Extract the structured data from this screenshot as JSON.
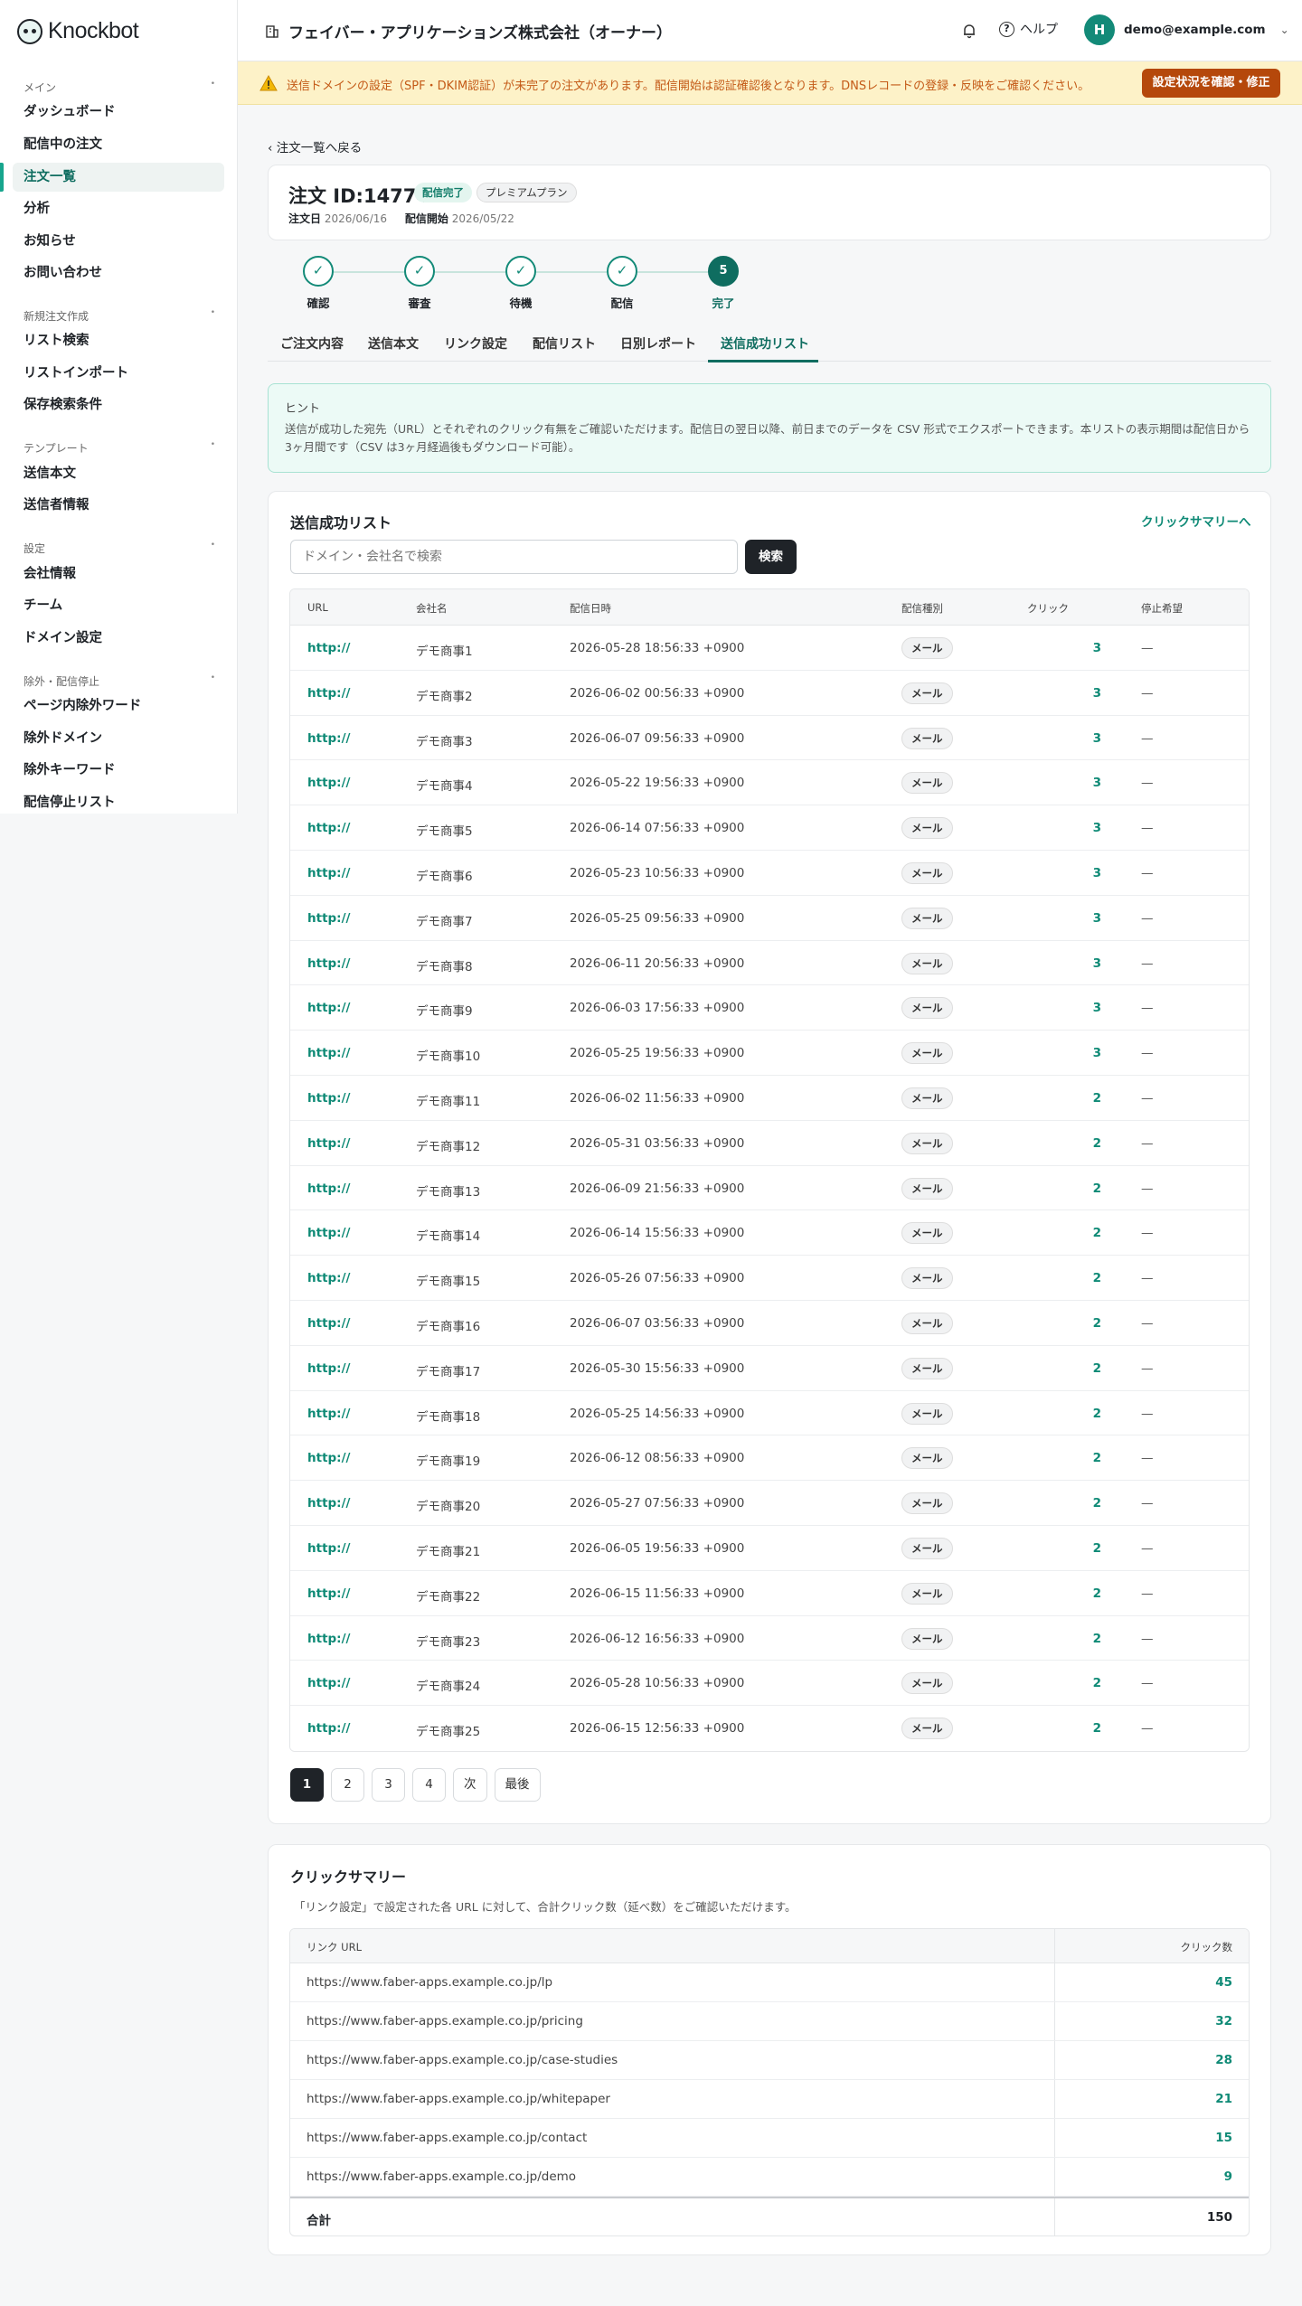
{
  "app": {
    "logo_text": "Knockbot"
  },
  "sidebar": {
    "sections": [
      {
        "label": "メイン",
        "items": [
          "ダッシュボード",
          "配信中の注文",
          "注文一覧",
          "分析",
          "お知らせ",
          "お問い合わせ"
        ]
      },
      {
        "label": "新規注文作成",
        "items": [
          "リスト検索",
          "リストインポート",
          "保存検索条件"
        ]
      },
      {
        "label": "テンプレート",
        "items": [
          "送信本文",
          "送信者情報"
        ]
      },
      {
        "label": "設定",
        "items": [
          "会社情報",
          "チーム",
          "ドメイン設定"
        ]
      },
      {
        "label": "除外・配信停止",
        "items": [
          "ページ内除外ワード",
          "除外ドメイン",
          "除外キーワード",
          "配信停止リスト"
        ]
      }
    ],
    "collapse_glyph": "•"
  },
  "header": {
    "company": "フェイバー・アプリケーションズ株式会社（オーナー）",
    "help": "ヘルプ",
    "help_glyph": "?",
    "avatar_letter": "H",
    "email": "demo@example.com",
    "chevron": "⌄"
  },
  "warning": {
    "text": "送信ドメインの設定（SPF・DKIM認証）が未完了の注文があります。配信開始は認証確認後となります。DNSレコードの登録・反映をご確認ください。",
    "button": "設定状況を確認・修正"
  },
  "back_link": "‹ 注文一覧へ戻る",
  "order": {
    "title": "注文 ID:14774",
    "status_badge": "配信完了",
    "plan_badge": "プレミアムプラン",
    "date_label": "注文日",
    "date_value": "2026/06/16",
    "start_label": "配信開始",
    "start_value": "2026/05/22"
  },
  "steps": [
    {
      "label": "確認",
      "mark": "✓"
    },
    {
      "label": "審査",
      "mark": "✓"
    },
    {
      "label": "待機",
      "mark": "✓"
    },
    {
      "label": "配信",
      "mark": "✓"
    },
    {
      "label": "完了",
      "mark": "5"
    }
  ],
  "tabs": [
    "ご注文内容",
    "送信本文",
    "リンク設定",
    "配信リスト",
    "日別レポート",
    "送信成功リスト"
  ],
  "hint": {
    "title": "ヒント",
    "text": "送信が成功した宛先（URL）とそれぞれのクリック有無をご確認いただけます。配信日の翌日以降、前日までのデータを CSV 形式でエクスポートできます。本リストの表示期間は配信日から3ヶ月間です（CSV は3ヶ月経過後もダウンロード可能）。"
  },
  "success_list": {
    "title": "送信成功リスト",
    "summary_link": "クリックサマリーへ",
    "search_placeholder": "ドメイン・会社名で検索",
    "search_button": "検索",
    "columns": [
      "URL",
      "会社名",
      "配信日時",
      "配信種別",
      "クリック",
      "停止希望"
    ],
    "rows": [
      [
        "http://",
        "デモ商事1",
        "2026-05-28 18:56:33 +0900",
        "メール",
        "3",
        "—"
      ],
      [
        "http://",
        "デモ商事2",
        "2026-06-02 00:56:33 +0900",
        "メール",
        "3",
        "—"
      ],
      [
        "http://",
        "デモ商事3",
        "2026-06-07 09:56:33 +0900",
        "メール",
        "3",
        "—"
      ],
      [
        "http://",
        "デモ商事4",
        "2026-05-22 19:56:33 +0900",
        "メール",
        "3",
        "—"
      ],
      [
        "http://",
        "デモ商事5",
        "2026-06-14 07:56:33 +0900",
        "メール",
        "3",
        "—"
      ],
      [
        "http://",
        "デモ商事6",
        "2026-05-23 10:56:33 +0900",
        "メール",
        "3",
        "—"
      ],
      [
        "http://",
        "デモ商事7",
        "2026-05-25 09:56:33 +0900",
        "メール",
        "3",
        "—"
      ],
      [
        "http://",
        "デモ商事8",
        "2026-06-11 20:56:33 +0900",
        "メール",
        "3",
        "—"
      ],
      [
        "http://",
        "デモ商事9",
        "2026-06-03 17:56:33 +0900",
        "メール",
        "3",
        "—"
      ],
      [
        "http://",
        "デモ商事10",
        "2026-05-25 19:56:33 +0900",
        "メール",
        "3",
        "—"
      ],
      [
        "http://",
        "デモ商事11",
        "2026-06-02 11:56:33 +0900",
        "メール",
        "2",
        "—"
      ],
      [
        "http://",
        "デモ商事12",
        "2026-05-31 03:56:33 +0900",
        "メール",
        "2",
        "—"
      ],
      [
        "http://",
        "デモ商事13",
        "2026-06-09 21:56:33 +0900",
        "メール",
        "2",
        "—"
      ],
      [
        "http://",
        "デモ商事14",
        "2026-06-14 15:56:33 +0900",
        "メール",
        "2",
        "—"
      ],
      [
        "http://",
        "デモ商事15",
        "2026-05-26 07:56:33 +0900",
        "メール",
        "2",
        "—"
      ],
      [
        "http://",
        "デモ商事16",
        "2026-06-07 03:56:33 +0900",
        "メール",
        "2",
        "—"
      ],
      [
        "http://",
        "デモ商事17",
        "2026-05-30 15:56:33 +0900",
        "メール",
        "2",
        "—"
      ],
      [
        "http://",
        "デモ商事18",
        "2026-05-25 14:56:33 +0900",
        "メール",
        "2",
        "—"
      ],
      [
        "http://",
        "デモ商事19",
        "2026-06-12 08:56:33 +0900",
        "メール",
        "2",
        "—"
      ],
      [
        "http://",
        "デモ商事20",
        "2026-05-27 07:56:33 +0900",
        "メール",
        "2",
        "—"
      ],
      [
        "http://",
        "デモ商事21",
        "2026-06-05 19:56:33 +0900",
        "メール",
        "2",
        "—"
      ],
      [
        "http://",
        "デモ商事22",
        "2026-06-15 11:56:33 +0900",
        "メール",
        "2",
        "—"
      ],
      [
        "http://",
        "デモ商事23",
        "2026-06-12 16:56:33 +0900",
        "メール",
        "2",
        "—"
      ],
      [
        "http://",
        "デモ商事24",
        "2026-05-28 10:56:33 +0900",
        "メール",
        "2",
        "—"
      ],
      [
        "http://",
        "デモ商事25",
        "2026-06-15 12:56:33 +0900",
        "メール",
        "2",
        "—"
      ]
    ],
    "pagination": [
      "1",
      "2",
      "3",
      "4",
      "次",
      "最後"
    ]
  },
  "click_summary": {
    "title": "クリックサマリー",
    "description": "「リンク設定」で設定された各 URL に対して、合計クリック数（延べ数）をご確認いただけます。",
    "columns": [
      "リンク URL",
      "クリック数"
    ],
    "rows": [
      [
        "https://www.faber-apps.example.co.jp/lp",
        "45"
      ],
      [
        "https://www.faber-apps.example.co.jp/pricing",
        "32"
      ],
      [
        "https://www.faber-apps.example.co.jp/case-studies",
        "28"
      ],
      [
        "https://www.faber-apps.example.co.jp/whitepaper",
        "21"
      ],
      [
        "https://www.faber-apps.example.co.jp/contact",
        "15"
      ],
      [
        "https://www.faber-apps.example.co.jp/demo",
        "9"
      ]
    ],
    "total_label": "合計",
    "total_value": "150"
  },
  "colors": {
    "accent": "#0f6d60",
    "link": "#0f8a76",
    "warning_bg": "#fdf2c8",
    "warning_button": "#b5480b"
  }
}
